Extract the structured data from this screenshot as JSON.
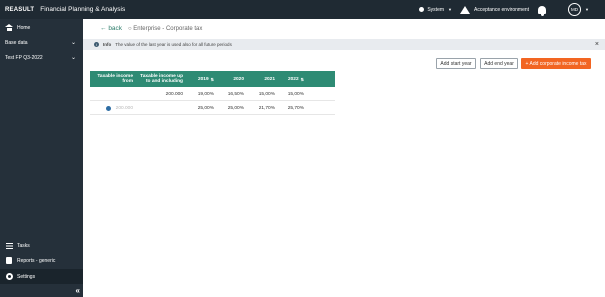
{
  "topbar": {
    "brand": "REASULT",
    "title": "Financial Planning & Analysis",
    "system_label": "System",
    "environment_label": "Acceptance environment",
    "avatar_initials": "MD"
  },
  "sidebar": {
    "items": [
      {
        "label": "Home",
        "icon": "home-icon"
      },
      {
        "label": "Base data",
        "icon": "none"
      },
      {
        "label": "Test FP Q3-2022",
        "icon": "none"
      },
      {
        "label": "Tasks",
        "icon": "list-icon"
      },
      {
        "label": "Reports - generic",
        "icon": "document-icon"
      },
      {
        "label": "Settings",
        "icon": "gear-icon"
      }
    ],
    "collapse_symbol": "«"
  },
  "header": {
    "back_label": "back",
    "breadcrumb": "Enterprise - Corporate tax"
  },
  "info": {
    "label": "Info",
    "message": "The value of the last year is used also for all future periods"
  },
  "buttons": {
    "add_start_year": "Add start year",
    "add_end_year": "Add end year",
    "add_corporate_tax": "+ Add corporate income tax"
  },
  "table": {
    "headers": {
      "from_line1": "Taxable income",
      "from_line2": "from",
      "to_line1": "Taxable income up",
      "to_line2": "to and including",
      "years": [
        "2019",
        "2020",
        "2021",
        "2022"
      ]
    },
    "rows": [
      {
        "from": "",
        "to": "200.000",
        "values": [
          "19,00%",
          "16,50%",
          "15,00%",
          "15,00%"
        ]
      },
      {
        "from": "200.000",
        "to": "",
        "values": [
          "25,00%",
          "25,00%",
          "21,70%",
          "25,70%"
        ]
      }
    ]
  },
  "colors": {
    "topbar": "#1f2a33",
    "sidebar": "#25303a",
    "table_header": "#2e8b74",
    "primary_button": "#f26522"
  }
}
